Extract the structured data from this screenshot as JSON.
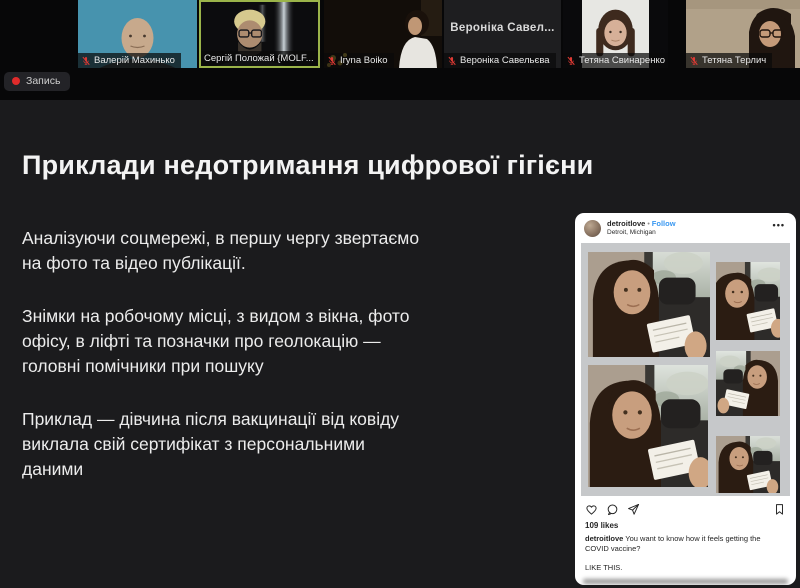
{
  "meeting": {
    "recording_label": "Запись",
    "participants": [
      {
        "name": "Валерій Махинько",
        "muted": true,
        "video": true
      },
      {
        "name": "Сергій Положай {MOLF...",
        "muted": false,
        "video": true,
        "speaking": true
      },
      {
        "name": "Iryna Boiko",
        "muted": true,
        "video": true
      },
      {
        "name": "Вероніка Савельєва",
        "overlay_name": "Вероніка Савел...",
        "muted": true,
        "video": false
      },
      {
        "name": "Тетяна Свинаренко",
        "muted": true,
        "video": true
      },
      {
        "name": "Тетяна Терлич",
        "muted": true,
        "video": true
      }
    ]
  },
  "slide": {
    "title": "Приклади недотримання цифрової гігієни",
    "paragraphs": [
      "Аналізуючи соцмережі, в першу чергу звертаємо\nна фото та відео публікації.",
      "Знімки на робочому місці, з видом з вікна, фото\nофісу, в ліфті та позначки про геолокацію —\nголовні помічники при пошуку",
      "Приклад — дівчина після вакцинації від ковіду\nвиклала свій сертифікат з персональними\nданими"
    ]
  },
  "instagram": {
    "username": "detroitlove",
    "separator": "•",
    "follow_label": "Follow",
    "location": "Detroit, Michigan",
    "more_icon": "•••",
    "likes": "109 likes",
    "caption_username": "detroitlove",
    "caption_text": " You want to know how it feels getting the COVID vaccine?",
    "caption_line2": "LIKE THIS."
  },
  "icons": {
    "muted_mic": "mic-off-red-slash",
    "record_dot": "red-dot",
    "like": "heart-outline",
    "comment": "speech-bubble-outline",
    "share": "paper-plane-outline",
    "save": "bookmark-outline"
  },
  "colors": {
    "follow_blue": "#3897f0",
    "speaking_border": "#9bb44a",
    "record_red": "#e02b2b",
    "slide_bg": "#1b1b1d",
    "mic_muted_red": "#e03a34"
  }
}
